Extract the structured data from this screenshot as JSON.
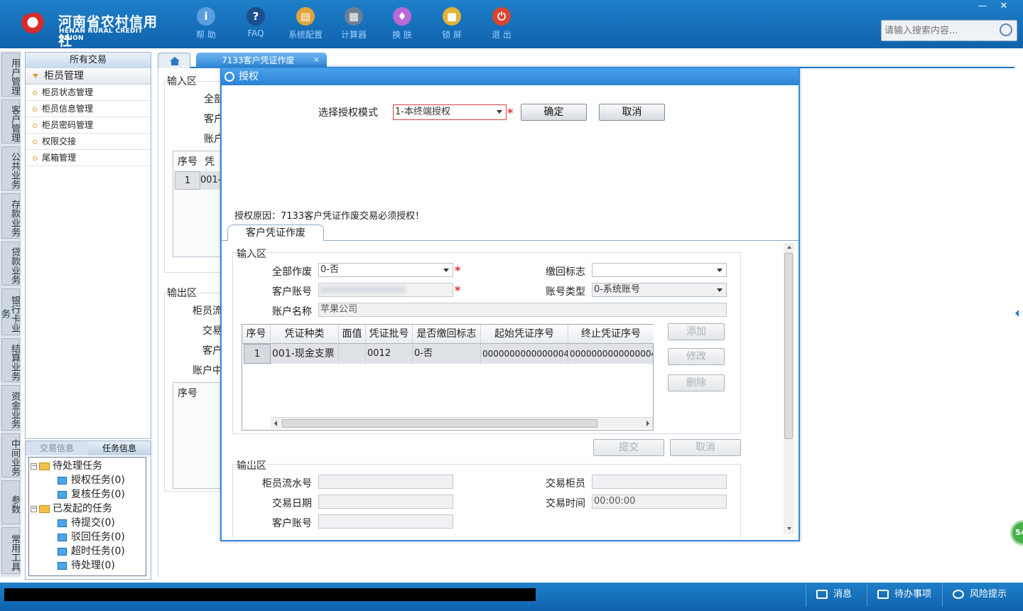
{
  "brand": {
    "name_cn": "河南省农村信用社",
    "name_en": "HENAN RURAL CREDIT UNION"
  },
  "toolbar": {
    "items": [
      {
        "label": "帮 助",
        "icon": "info-icon",
        "glyph": "i",
        "color": "#5a9ee0"
      },
      {
        "label": "FAQ",
        "icon": "help-icon",
        "glyph": "?",
        "color": "#1b4f8e"
      },
      {
        "label": "系统配置",
        "icon": "toolbox-icon",
        "glyph": "▤",
        "color": "#e0a43a"
      },
      {
        "label": "计算器",
        "icon": "calculator-icon",
        "glyph": "▦",
        "color": "#6d7f92"
      },
      {
        "label": "换 肤",
        "icon": "shirt-icon",
        "glyph": "♦",
        "color": "#b86ad6"
      },
      {
        "label": "锁 屏",
        "icon": "lock-icon",
        "glyph": "■",
        "color": "#e2b23a"
      },
      {
        "label": "退 出",
        "icon": "power-icon",
        "glyph": "⏻",
        "color": "#d9442f"
      }
    ]
  },
  "window": {
    "minimize": "—",
    "close": "✕"
  },
  "search": {
    "placeholder": "请输入搜索内容..."
  },
  "vtabs": [
    "用户管理",
    "客户管理",
    "公共业务",
    "存款业务",
    "贷款业务",
    "银行卡业务",
    "结算业务",
    "资金业务",
    "中间业务",
    "参数",
    "常用工具"
  ],
  "left_panel": {
    "header": "所有交易",
    "group": "柜员管理",
    "items": [
      "柜员状态管理",
      "柜员信息管理",
      "柜员密码管理",
      "权限交接",
      "尾箱管理"
    ]
  },
  "task_panel": {
    "tab_trade": "交易信息",
    "tab_task": "任务信息",
    "pending_root": "待处理任务",
    "pending": [
      "授权任务(0)",
      "复核任务(0)"
    ],
    "started_root": "已发起的任务",
    "started": [
      "待提交(0)",
      "驳回任务(0)",
      "超时任务(0)",
      "待处理(0)"
    ]
  },
  "tabs": {
    "active": "7133客户凭证作废"
  },
  "bg": {
    "input_area": "输入区",
    "l1": "全部",
    "l2": "客户",
    "l3": "账户",
    "th_seq": "序号",
    "th_type": "凭证",
    "row_seq": "1",
    "row_type": "001-",
    "output_area": "输出区",
    "o1": "柜员流",
    "o2": "交易",
    "o3": "客户",
    "o4": "账户中",
    "th2_seq": "序号"
  },
  "dialog": {
    "title": "授权",
    "mode_label": "选择授权模式",
    "mode_value": "1-本终端授权",
    "confirm": "确定",
    "cancel": "取消",
    "reason": "授权原因：7133客户凭证作废交易必须授权！",
    "tab": "客户凭证作废",
    "input_area": "输入区",
    "all_void_label": "全部作废",
    "all_void_value": "0-否",
    "return_flag_label": "缴回标志",
    "return_flag_value": "",
    "acct_label": "客户账号",
    "acct_value": "",
    "acct_type_label": "账号类型",
    "acct_type_value": "0-系统账号",
    "acct_name_label": "账户名称",
    "acct_name_value": "苹果公司",
    "table": {
      "headers": [
        "序号",
        "凭证种类",
        "面值",
        "凭证批号",
        "是否缴回标志",
        "起始凭证序号",
        "终止凭证序号"
      ],
      "rows": [
        [
          "1",
          "001-现金支票",
          "",
          "0012",
          "0-否",
          "0000000000000004",
          "0000000000000004"
        ]
      ]
    },
    "btn_add": "添加",
    "btn_edit": "修改",
    "btn_delete": "删除",
    "btn_submit": "提交",
    "btn_cancel": "取消",
    "output_area": "输出区",
    "teller_seq_label": "柜员流水号",
    "teller_seq_value": "",
    "trade_teller_label": "交易柜员",
    "trade_teller_value": "",
    "trade_date_label": "交易日期",
    "trade_date_value": "",
    "trade_time_label": "交易时间",
    "trade_time_value": "00:00:00",
    "out_acct_label": "客户账号",
    "out_acct_value": ""
  },
  "statusbar": {
    "messages": "消息",
    "todo": "待办事项",
    "risk": "风险提示"
  },
  "float_badge": "54"
}
